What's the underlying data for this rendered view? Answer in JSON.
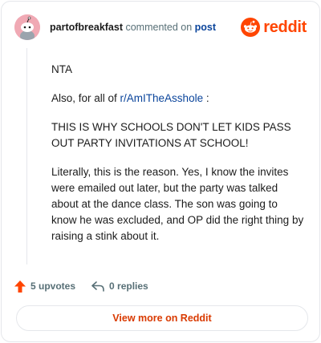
{
  "header": {
    "username": "partofbreakfast",
    "verb": "commented on",
    "post_link": "post",
    "brand": "reddit"
  },
  "comment": {
    "p1": "NTA",
    "p2_prefix": "Also, for all of ",
    "p2_link": "r/AmITheAsshole",
    "p2_suffix": " :",
    "p3": "THIS IS WHY SCHOOLS DON'T LET KIDS PASS OUT PARTY INVITATIONS AT SCHOOL!",
    "p4": "Literally, this is the reason. Yes, I know the invites were emailed out later, but the party was talked about at the dance class. The son was going to know he was excluded, and OP did the right thing by raising a stink about it."
  },
  "footer": {
    "upvotes": "5 upvotes",
    "replies": "0 replies"
  },
  "cta": {
    "label": "View more on Reddit"
  },
  "colors": {
    "accent": "#ff4500",
    "link": "#0a449b",
    "cta_text": "#d93a00",
    "avatar_bg": "#f0a9b4"
  },
  "icons": {
    "avatar": "snoo-avatar",
    "brand": "reddit-logo-icon",
    "upvote": "upvote-arrow-icon",
    "reply": "reply-arrow-icon"
  }
}
